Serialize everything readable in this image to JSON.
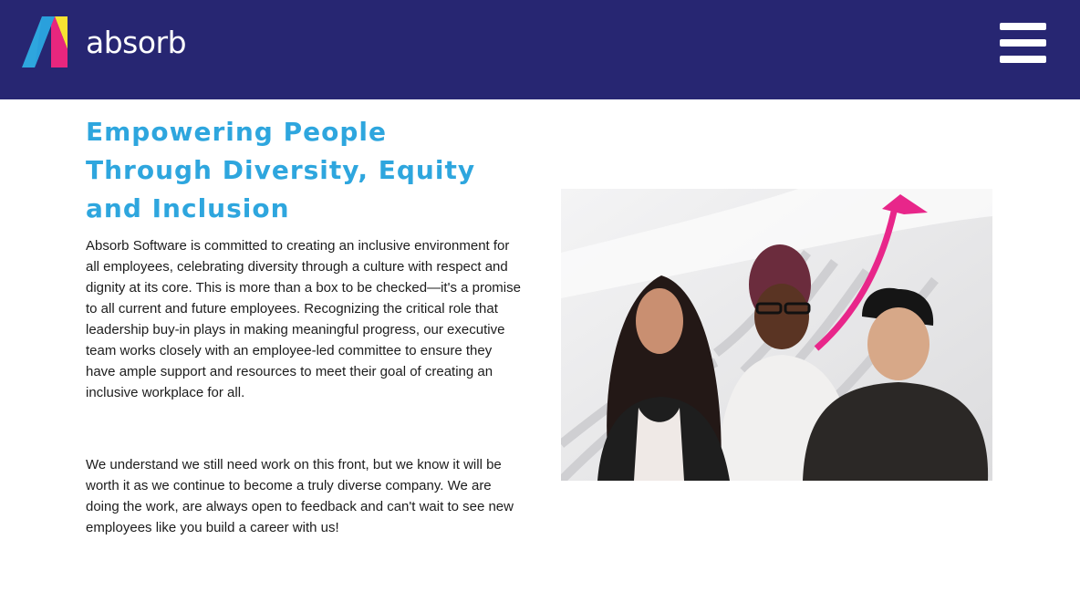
{
  "header": {
    "brand_name": "absorb",
    "logo_icon": "absorb-logo-icon",
    "menu_icon": "hamburger-menu-icon",
    "background_color": "#272672",
    "logo_colors": [
      "#2ea6de",
      "#f7e331",
      "#e8267e"
    ]
  },
  "main": {
    "title": "Empowering People Through Diversity, Equity and Inclusion",
    "title_color": "#2ea6de",
    "paragraph_1": "Absorb Software is committed to creating an inclusive environment for all employees, celebrating diversity through a culture with respect and dignity at its core. This is more than a box to be checked—it's a promise to all current and future employees. Recognizing the critical role that leadership buy-in plays in making meaningful progress, our executive team works closely with an employee-led committee to ensure they have ample support and resources to meet their goal of creating an inclusive workplace for all.",
    "paragraph_2": "We understand we still need work on this front, but we know it will be worth it as we continue to become a truly diverse company. We are doing the work, are always open to feedback and can't wait to see new employees like you build a career with us!"
  },
  "hero_image": {
    "icon": "upward-arrow-icon",
    "accent_color": "#e8268a"
  }
}
